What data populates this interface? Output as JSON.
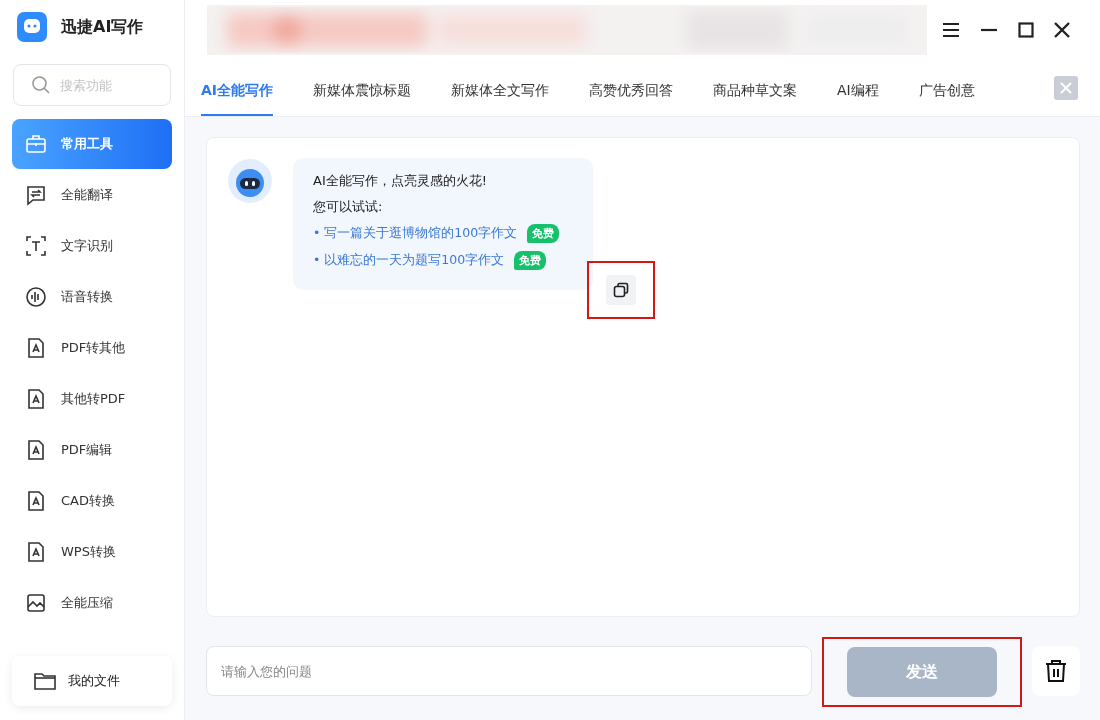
{
  "app": {
    "title": "迅捷AI写作"
  },
  "sidebar": {
    "search": {
      "placeholder": "搜索功能"
    },
    "items": [
      {
        "label": "常用工具",
        "selected": true
      },
      {
        "label": "全能翻译",
        "selected": false
      },
      {
        "label": "文字识别",
        "selected": false
      },
      {
        "label": "语音转换",
        "selected": false
      },
      {
        "label": "PDF转其他",
        "selected": false
      },
      {
        "label": "其他转PDF",
        "selected": false
      },
      {
        "label": "PDF编辑",
        "selected": false
      },
      {
        "label": "CAD转换",
        "selected": false
      },
      {
        "label": "WPS转换",
        "selected": false
      },
      {
        "label": "全能压缩",
        "selected": false
      }
    ],
    "files_button": "我的文件"
  },
  "tabs": [
    {
      "label": "AI全能写作",
      "selected": true
    },
    {
      "label": "新媒体震惊标题",
      "selected": false
    },
    {
      "label": "新媒体全文写作",
      "selected": false
    },
    {
      "label": "高赞优秀回答",
      "selected": false
    },
    {
      "label": "商品种草文案",
      "selected": false
    },
    {
      "label": "AI编程",
      "selected": false
    },
    {
      "label": "广告创意",
      "selected": false
    }
  ],
  "message": {
    "greeting": "AI全能写作，点亮灵感的火花!",
    "hint": "您可以试试:",
    "suggestions": [
      {
        "text": "• 写一篇关于逛博物馆的100字作文",
        "badge": "免费"
      },
      {
        "text": "• 以难忘的一天为题写100字作文",
        "badge": "免费"
      }
    ]
  },
  "input": {
    "placeholder": "请输入您的问题"
  },
  "send_button": {
    "label": "发送",
    "disabled": true
  }
}
